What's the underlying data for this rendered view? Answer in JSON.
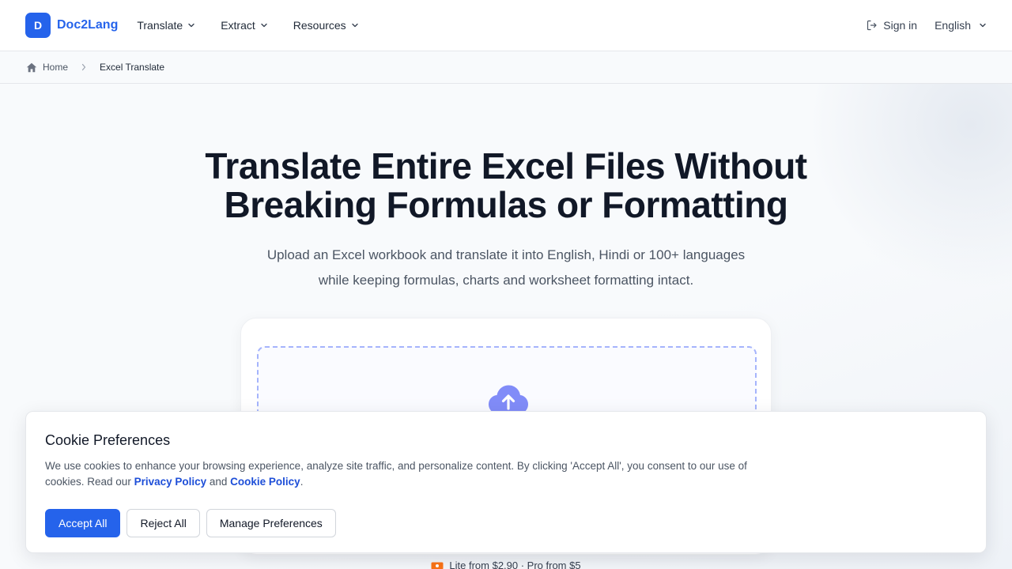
{
  "brand": {
    "logo_letter": "D",
    "name": "Doc2Lang"
  },
  "nav": {
    "items": [
      {
        "label": "Translate"
      },
      {
        "label": "Extract"
      },
      {
        "label": "Resources"
      }
    ],
    "sign_in": "Sign in",
    "language": "English"
  },
  "breadcrumb": {
    "home": "Home",
    "current": "Excel Translate"
  },
  "hero": {
    "title_line1": "Translate Entire Excel Files Without",
    "title_line2": "Breaking Formulas or Formatting",
    "subtitle_line1": "Upload an Excel workbook and translate it into English, Hindi or 100+ languages",
    "subtitle_line2": "while keeping formulas, charts and worksheet formatting intact.",
    "pricing": "Lite from $2.90 · Pro from $5"
  },
  "cookie": {
    "title": "Cookie Preferences",
    "text_before": "We use cookies to enhance your browsing experience, analyze site traffic, and personalize content. By clicking 'Accept All', you consent to our use of cookies. Read our ",
    "privacy_link": "Privacy Policy",
    "and": " and ",
    "cookie_link": "Cookie Policy",
    "period": ".",
    "accept_label": "Accept All",
    "reject_label": "Reject All",
    "manage_label": "Manage Preferences"
  },
  "colors": {
    "accent": "#2563eb",
    "dropzone_border": "#a5b4fc",
    "upload_icon": "#818cf8",
    "pricing_icon": "#f97316"
  },
  "icons": {
    "sign_in": "sign-in-icon",
    "home": "home-icon",
    "breadcrumb_separator": "chevron-right-icon",
    "upload": "cloud-upload-icon",
    "pricing": "ticket-icon"
  }
}
